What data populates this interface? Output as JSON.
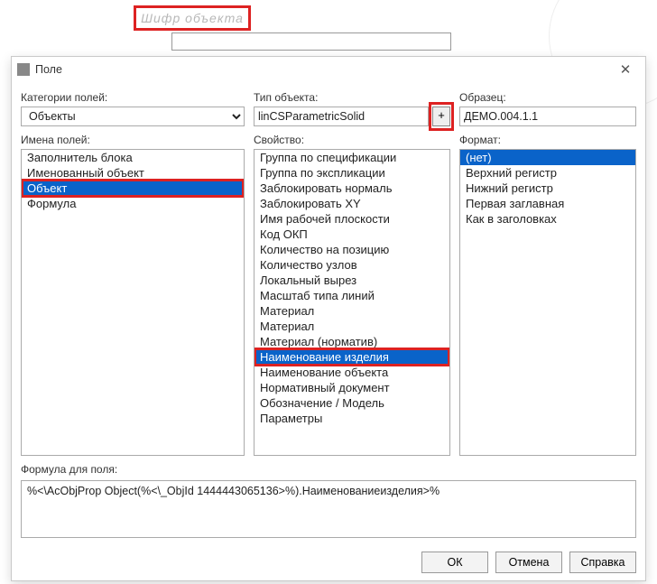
{
  "annotation_top": "Шифр объекта",
  "dialog": {
    "title": "Поле",
    "labels": {
      "categories": "Категории полей:",
      "obj_type": "Тип объекта:",
      "sample": "Образец:",
      "field_names": "Имена полей:",
      "property": "Свойство:",
      "format": "Формат:",
      "formula": "Формула для поля:"
    },
    "category_value": "Объекты",
    "obj_type_value": "linCSParametricSolid",
    "plus_label": "+",
    "sample_value": "ДЕМО.004.1.1",
    "field_names_list": [
      "Заполнитель блока",
      "Именованный объект",
      "Объект",
      "Формула"
    ],
    "field_names_selected": 2,
    "property_list": [
      "Группа по спецификации",
      "Группа по экспликации",
      "Заблокировать нормаль",
      "Заблокировать XY",
      "Имя рабочей плоскости",
      "Код ОКП",
      "Количество на позицию",
      "Количество узлов",
      "Локальный вырез",
      "Масштаб типа линий",
      "Материал",
      "Материал",
      "Материал (норматив)",
      "Наименование изделия",
      "Наименование объекта",
      "Нормативный документ",
      "Обозначение / Модель",
      "Параметры"
    ],
    "property_selected": 13,
    "format_list": [
      "(нет)",
      "Верхний регистр",
      "Нижний регистр",
      "Первая заглавная",
      "Как в заголовках"
    ],
    "format_selected": 0,
    "formula_value": "%<\\AcObjProp Object(%<\\_ObjId 1444443065136>%).Наименованиеизделия>%",
    "buttons": {
      "ok": "ОК",
      "cancel": "Отмена",
      "help": "Справка"
    }
  }
}
